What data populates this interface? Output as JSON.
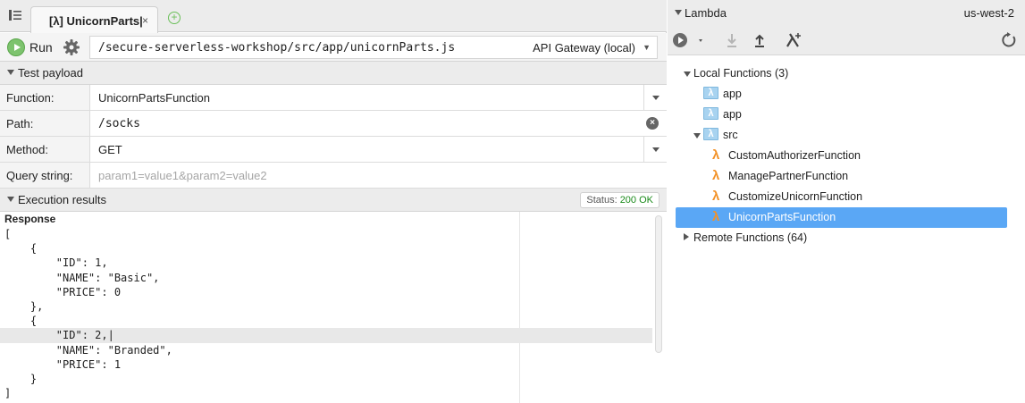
{
  "editor": {
    "tab_title": "[λ] UnicornParts|",
    "tab_close": "×",
    "tab_add": "+"
  },
  "runbar": {
    "run_label": "Run",
    "file_path": "/secure-serverless-workshop/src/app/unicornParts.js",
    "run_mode": "API Gateway (local)"
  },
  "payload": {
    "header": "Test payload",
    "function_label": "Function:",
    "function_value": "UnicornPartsFunction",
    "path_label": "Path:",
    "path_value": "/socks",
    "method_label": "Method:",
    "method_value": "GET",
    "query_label": "Query string:",
    "query_placeholder": "param1=value1&param2=value2"
  },
  "results": {
    "header": "Execution results",
    "status_prefix": "Status: ",
    "status_value": "200 OK",
    "response_title": "Response",
    "lines": [
      "[",
      "    {",
      "        \"ID\": 1,",
      "        \"NAME\": \"Basic\",",
      "        \"PRICE\": 0",
      "    },",
      "    {",
      "        \"ID\": 2,|",
      "        \"NAME\": \"Branded\",",
      "        \"PRICE\": 1",
      "    }",
      "]"
    ]
  },
  "lambda": {
    "title": "Lambda",
    "region": "us-west-2",
    "local_functions": "Local Functions (3)",
    "folder_app_1": "app",
    "folder_app_2": "app",
    "folder_src": "src",
    "functions": [
      "CustomAuthorizerFunction",
      "ManagePartnerFunction",
      "CustomizeUnicornFunction",
      "UnicornPartsFunction"
    ],
    "remote_functions": "Remote Functions (64)"
  },
  "colors": {
    "run_green": "#7dc36e",
    "lambda_orange": "#f29228",
    "selection_blue": "#5aa7f5",
    "status_ok_green": "#1a8a1a"
  },
  "icons": [
    "tab-list-icon",
    "add-tab-icon",
    "run-icon",
    "gear-icon",
    "clear-icon",
    "lambda-run-icon",
    "download-icon",
    "upload-icon",
    "create-lambda-icon",
    "refresh-icon",
    "folder-icon",
    "lambda-icon"
  ]
}
